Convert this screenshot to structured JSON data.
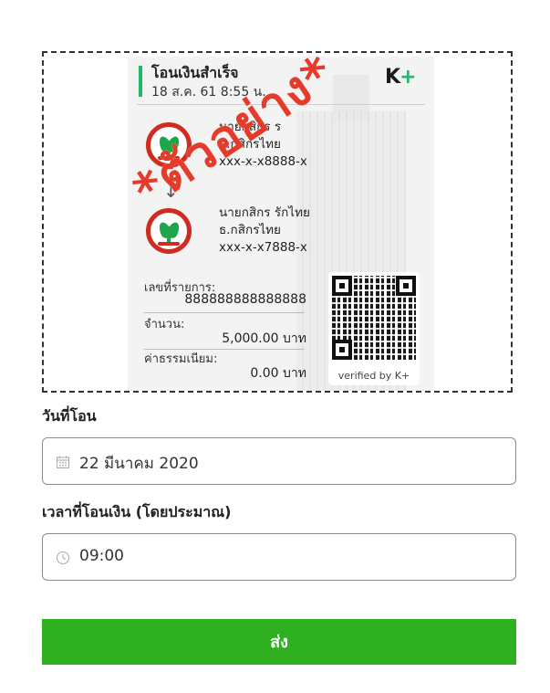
{
  "slip": {
    "title": "โอนเงินสำเร็จ",
    "datetime": "18 ส.ค. 61 8:55 น.",
    "brand_main": "K",
    "brand_plus": "+",
    "from": {
      "name": "นายกสิกร ร",
      "bank": "ธ.กสิกรไทย",
      "account": "xxx-x-x8888-x"
    },
    "to": {
      "name": "นายกสิกร รักไทย",
      "bank": "ธ.กสิกรไทย",
      "account": "xxx-x-x7888-x"
    },
    "ref_label": "เลขที่รายการ:",
    "ref_value": "888888888888888",
    "amount_label": "จำนวน:",
    "amount_value": "5,000.00 บาท",
    "fee_label": "ค่าธรรมเนียม:",
    "fee_value": "0.00 บาท",
    "verified": "verified by K+"
  },
  "watermark": "*ตัวอย่าง*",
  "form": {
    "date_label": "วันที่โอน",
    "date_value": "22 มีนาคม 2020",
    "time_label": "เวลาที่โอนเงิน (โดยประมาณ)",
    "time_value": "09:00",
    "submit_label": "ส่ง"
  },
  "colors": {
    "accent": "#2fb021",
    "watermark": "#e53b2a",
    "bank_red": "#d02b20",
    "bank_green": "#1fa64b"
  }
}
